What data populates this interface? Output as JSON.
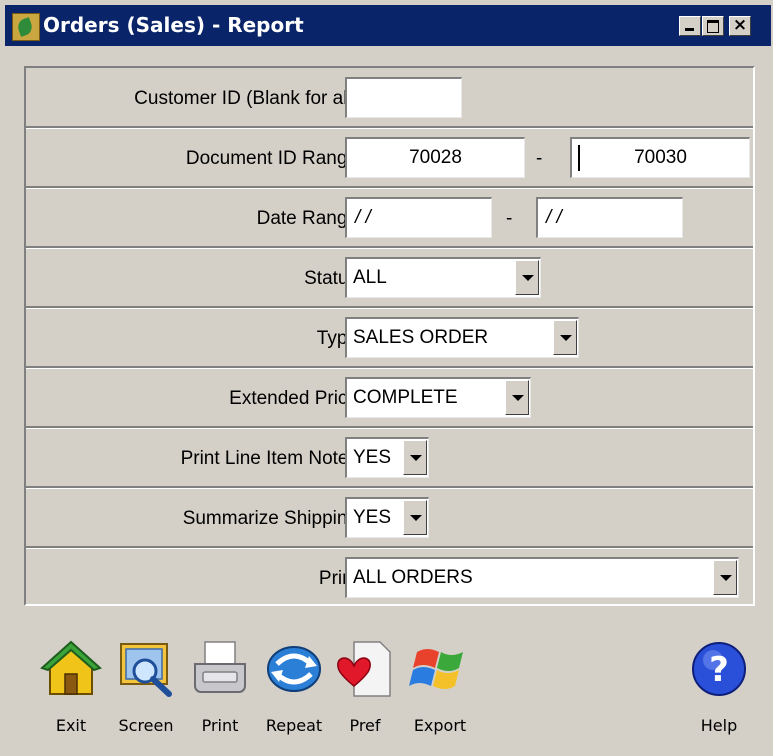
{
  "window": {
    "title": "Orders (Sales) - Report",
    "close_glyph": "×"
  },
  "form": {
    "customer_id": {
      "label": "Customer ID (Blank for all)",
      "value": ""
    },
    "document_id_range": {
      "label": "Document ID Range",
      "from": "70028",
      "separator": "-",
      "to": "70030"
    },
    "date_range": {
      "label": "Date Range",
      "from": "/ /",
      "separator": "-",
      "to": "/ /"
    },
    "status": {
      "label": "Status",
      "value": "ALL"
    },
    "type": {
      "label": "Type",
      "value": "SALES ORDER"
    },
    "extended_price": {
      "label": "Extended Price",
      "value": "COMPLETE"
    },
    "print_line_item_notes": {
      "label": "Print Line Item Notes",
      "value": "YES"
    },
    "summarize_shipping": {
      "label": "Summarize Shipping",
      "value": "YES"
    },
    "print": {
      "label": "Print",
      "value": "ALL ORDERS"
    }
  },
  "toolbar": {
    "exit": {
      "label": "Exit",
      "icon": "home-icon"
    },
    "screen": {
      "label": "Screen",
      "icon": "magnifier-screen-icon"
    },
    "print": {
      "label": "Print",
      "icon": "printer-icon"
    },
    "repeat": {
      "label": "Repeat",
      "icon": "repeat-arrows-icon"
    },
    "pref": {
      "label": "Pref",
      "icon": "heart-document-icon"
    },
    "export": {
      "label": "Export",
      "icon": "windows-flag-icon"
    },
    "help": {
      "label": "Help",
      "icon": "help-question-icon"
    }
  },
  "colors": {
    "titlebar": "#0a246a",
    "window_bg": "#d4d0c8",
    "help_blue": "#2a4fd8"
  }
}
